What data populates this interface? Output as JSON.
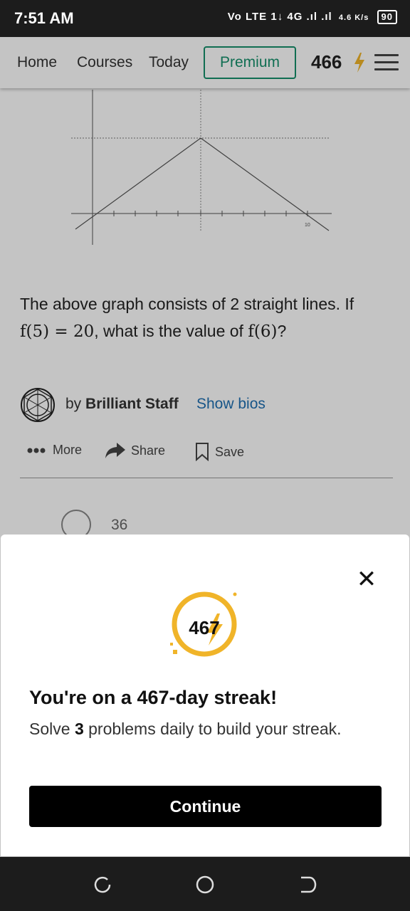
{
  "status_bar": {
    "time": "7:51 AM",
    "indicators": "Vo LTE 1↓ 4G .ıl .ıl",
    "speed": "4.6 K/s",
    "battery": "90"
  },
  "nav": {
    "home": "Home",
    "courses": "Courses",
    "today": "Today",
    "premium": "Premium",
    "streak_count": "466"
  },
  "graph": {
    "x_tick_label": "10"
  },
  "question": {
    "line1": "The above graph consists of 2 straight lines. If",
    "math1": "f(5) = 20",
    "mid": ", what is the value of ",
    "math2": "f(6)",
    "end": "?"
  },
  "author": {
    "by": "by",
    "name": "Brilliant Staff",
    "show_bios": "Show bios"
  },
  "actions": {
    "more": "More",
    "share": "Share",
    "save": "Save"
  },
  "options": [
    {
      "value": "36"
    }
  ],
  "streak_sheet": {
    "badge_number": "467",
    "title": "You're on a 467-day streak!",
    "text_before": "Solve",
    "bold_count": "3",
    "text_after": "problems daily to build your streak.",
    "continue_label": "Continue"
  },
  "colors": {
    "premium_green": "#15906b",
    "streak_gold": "#f0b429",
    "link_blue": "#1f6fb2"
  }
}
